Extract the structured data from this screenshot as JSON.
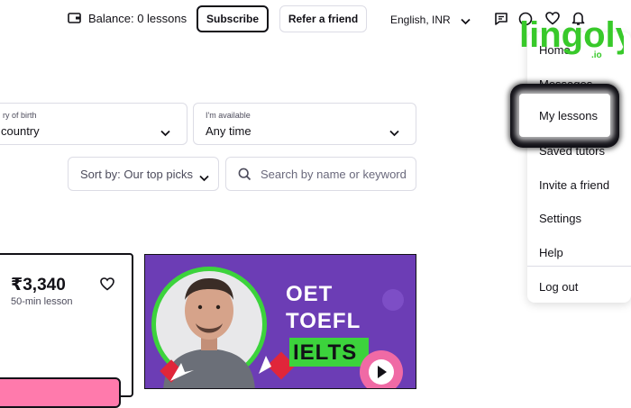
{
  "header": {
    "balance": "Balance: 0 lessons",
    "subscribe": "Subscribe",
    "refer": "Refer a friend",
    "locale": "English, INR"
  },
  "filters": {
    "country_label": "ry of birth",
    "country_value": "country",
    "available_label": "I'm available",
    "available_value": "Any time",
    "sort": "Sort by: Our top picks",
    "search_placeholder": "Search by name or keyword"
  },
  "tutor_card": {
    "price": "₹3,340",
    "duration": "50-min lesson"
  },
  "video_card": {
    "line1": "OET",
    "line2": "TOEFL",
    "line3": "IELTS"
  },
  "menu": {
    "items": [
      "Home",
      "Messages",
      "My lessons",
      "Saved tutors",
      "Invite a friend",
      "Settings",
      "Help",
      "Log out"
    ]
  },
  "watermark": {
    "text": "lingoly",
    "sub": ".io"
  },
  "colors": {
    "brand_pink": "#ff7aac",
    "video_purple": "#6c3db5",
    "ielts_green": "#3cd33c",
    "watermark_green": "#38c92a"
  }
}
